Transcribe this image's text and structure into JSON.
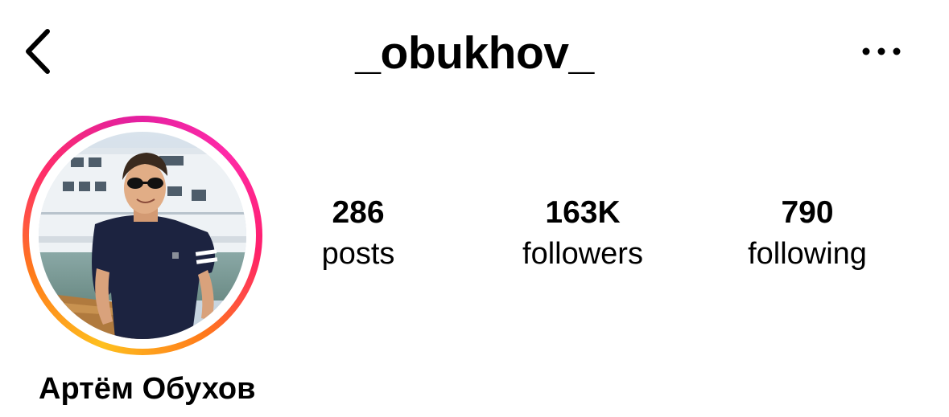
{
  "header": {
    "username": "_obukhov_",
    "back_icon": "chevron-left-icon",
    "more_icon": "ellipsis-horizontal-icon"
  },
  "profile": {
    "full_name": "Артём Обухов",
    "has_story_ring": true,
    "story_ring_colors": [
      "#fec01f",
      "#ff7a1a",
      "#ff2d6a",
      "#e3209f"
    ]
  },
  "stats": {
    "posts": {
      "value": "286",
      "label": "posts"
    },
    "followers": {
      "value": "163K",
      "label": "followers"
    },
    "following": {
      "value": "790",
      "label": "following"
    }
  }
}
